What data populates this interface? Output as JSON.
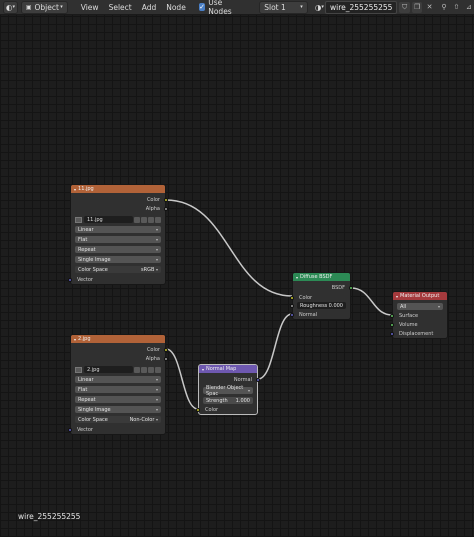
{
  "header": {
    "editor_icon": "node-editor-icon",
    "mode": "Object",
    "menus": [
      "View",
      "Select",
      "Add",
      "Node"
    ],
    "use_nodes_label": "Use Nodes",
    "use_nodes_checked": true,
    "slot": "Slot 1",
    "material_name": "wire_255255255"
  },
  "nodes": {
    "tex1": {
      "title": "11.jpg",
      "out_color": "Color",
      "out_alpha": "Alpha",
      "image": "11.jpg",
      "interpolation": "Linear",
      "projection": "Flat",
      "extension": "Repeat",
      "source": "Single Image",
      "colorspace_label": "Color Space",
      "colorspace_value": "sRGB",
      "in_vector": "Vector"
    },
    "tex2": {
      "title": "2.jpg",
      "out_color": "Color",
      "out_alpha": "Alpha",
      "image": "2.jpg",
      "interpolation": "Linear",
      "projection": "Flat",
      "extension": "Repeat",
      "source": "Single Image",
      "colorspace_label": "Color Space",
      "colorspace_value": "Non-Color",
      "in_vector": "Vector"
    },
    "normalmap": {
      "title": "Normal Map",
      "out_normal": "Normal",
      "space": "Blender Object Spac",
      "strength_label": "Strength",
      "strength_value": "1.000",
      "in_color": "Color"
    },
    "diffuse": {
      "title": "Diffuse BSDF",
      "out_bsdf": "BSDF",
      "in_color": "Color",
      "roughness_label": "Roughness",
      "roughness_value": "0.000",
      "in_normal": "Normal"
    },
    "output": {
      "title": "Material Output",
      "target": "All",
      "in_surface": "Surface",
      "in_volume": "Volume",
      "in_displacement": "Displacement"
    }
  },
  "view_label": "wire_255255255"
}
